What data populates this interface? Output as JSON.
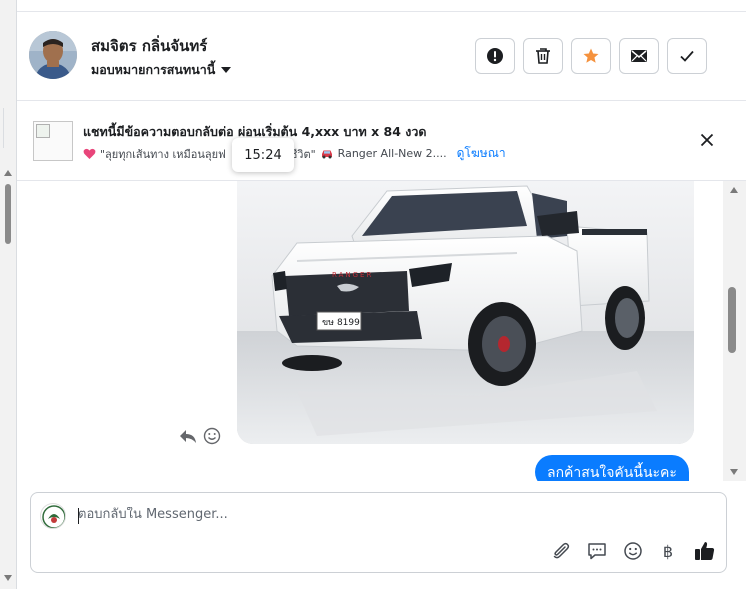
{
  "header": {
    "contact_name": "สมจิตร กลิ่นจันทร์",
    "assign_label": "มอบหมายการสนทนานี้",
    "actions": [
      {
        "id": "spam",
        "icon": "exclamation-circle-icon"
      },
      {
        "id": "delete",
        "icon": "trash-icon"
      },
      {
        "id": "star",
        "icon": "star-icon",
        "color": "#f5923e"
      },
      {
        "id": "unread",
        "icon": "envelope-icon"
      },
      {
        "id": "done",
        "icon": "checkmark-icon"
      }
    ]
  },
  "ad_banner": {
    "title": "แชทนี้มีข้อความตอบกลับต่อ ผ่อนเริ่มต้น 4,xxx บาท x 84 งวด",
    "quote_left": "\"ลุยทุกเส้นทาง เหมือนลุยฟ",
    "quote_right": "ชีวิต\"",
    "product": "Ranger All-New 2....",
    "view_ad_link": "ดูโฆษณา"
  },
  "tooltip": {
    "time": "15:24"
  },
  "messages": {
    "image_alt": "Ford Ranger white pickup",
    "plate_text": "ขษ 8199",
    "grille_text": "RANGER",
    "outgoing_text": "ลกค้าสนใจคันนี้นะคะ"
  },
  "composer": {
    "placeholder": "ตอบกลับใน Messenger..."
  },
  "colors": {
    "accent": "#0a7cff",
    "star": "#f5923e",
    "like": "#1c1e21"
  }
}
